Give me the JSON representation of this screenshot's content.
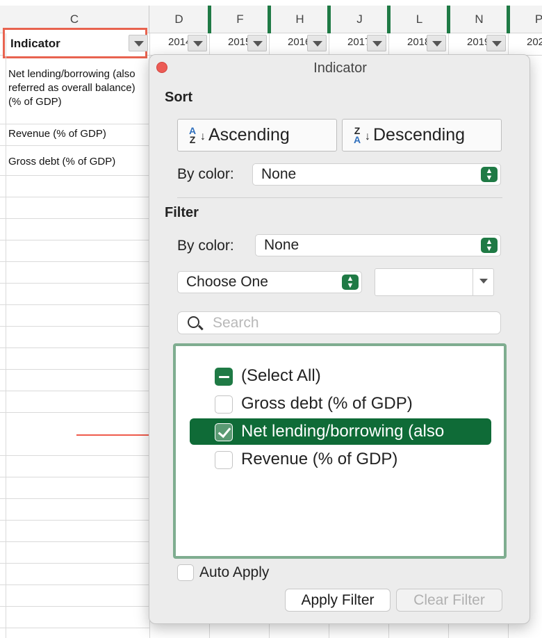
{
  "columns": [
    {
      "id": "C",
      "label": "C"
    },
    {
      "id": "D",
      "label": "D"
    },
    {
      "id": "F",
      "label": "F"
    },
    {
      "id": "H",
      "label": "H"
    },
    {
      "id": "J",
      "label": "J"
    },
    {
      "id": "L",
      "label": "L"
    },
    {
      "id": "N",
      "label": "N"
    },
    {
      "id": "P",
      "label": "P"
    }
  ],
  "header_cell": {
    "label": "Indicator"
  },
  "years": [
    "2014",
    "2015",
    "2016",
    "2017",
    "2018",
    "2019",
    "202"
  ],
  "rows": [
    {
      "text": "Net lending/borrowing (also referred as overall balance) (% of GDP)"
    },
    {
      "text": "Revenue (% of GDP)"
    },
    {
      "text": "Gross debt (% of GDP)"
    }
  ],
  "popup": {
    "title": "Indicator",
    "sort": {
      "heading": "Sort",
      "ascending_label": "Ascending",
      "descending_label": "Descending",
      "by_color_label": "By color:",
      "by_color_value": "None"
    },
    "filter": {
      "heading": "Filter",
      "by_color_label": "By color:",
      "by_color_value": "None",
      "choose_value": "Choose One",
      "search_placeholder": "Search"
    },
    "list": [
      {
        "label": "(Select All)",
        "state": "mixed"
      },
      {
        "label": "Gross debt (% of GDP)",
        "state": "unchecked"
      },
      {
        "label": "Net lending/borrowing (also",
        "state": "checked"
      },
      {
        "label": "Revenue (% of GDP)",
        "state": "unchecked"
      }
    ],
    "auto_apply_label": "Auto Apply",
    "apply_label": "Apply Filter",
    "clear_label": "Clear Filter"
  },
  "colors": {
    "accent": "#1f7a45",
    "highlight": "#0f6b37",
    "annotation": "#ef5a4b"
  }
}
